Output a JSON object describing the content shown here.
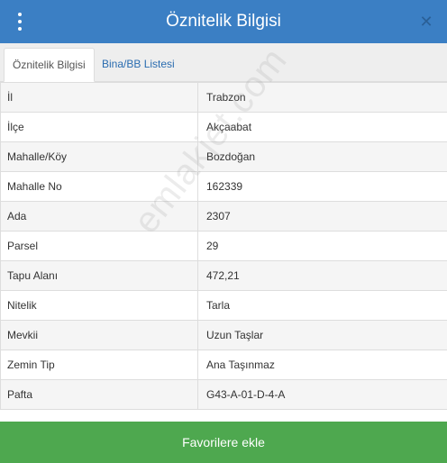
{
  "header": {
    "title": "Öznitelik Bilgisi",
    "menu_icon": "vertical-dots-icon",
    "close_icon": "close-icon",
    "close_glyph": "✕",
    "background_color": "#3b7fc4"
  },
  "tabs": [
    {
      "label": "Öznitelik Bilgisi",
      "active": true
    },
    {
      "label": "Bina/BB Listesi",
      "active": false
    }
  ],
  "attributes": [
    {
      "key": "İl",
      "value": "Trabzon"
    },
    {
      "key": "İlçe",
      "value": "Akçaabat"
    },
    {
      "key": "Mahalle/Köy",
      "value": "Bozdoğan"
    },
    {
      "key": "Mahalle No",
      "value": "162339"
    },
    {
      "key": "Ada",
      "value": "2307"
    },
    {
      "key": "Parsel",
      "value": "29"
    },
    {
      "key": "Tapu Alanı",
      "value": "472,21"
    },
    {
      "key": "Nitelik",
      "value": "Tarla"
    },
    {
      "key": "Mevkii",
      "value": "Uzun Taşlar"
    },
    {
      "key": "Zemin Tip",
      "value": "Ana Taşınmaz"
    },
    {
      "key": "Pafta",
      "value": "G43-A-01-D-4-A"
    }
  ],
  "watermark": "emlakjet.com",
  "footer": {
    "button_label": "Favorilere ekle",
    "button_color": "#4ea84f"
  }
}
